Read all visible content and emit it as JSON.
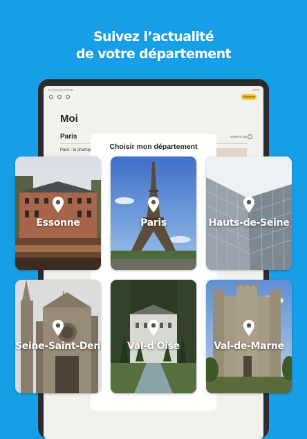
{
  "headline": {
    "line1": "Suivez l’actualité",
    "line2": "de votre département"
  },
  "tablet": {
    "status_left": "09:30 jeudi 18 février",
    "status_right": "100%",
    "subscribe_button": "S'abonner",
    "page_title": "Moi",
    "tab_label": "Paris",
    "see_more": "VOIR PLUS",
    "snippet": "Paris : le champi"
  },
  "modal": {
    "title": "Choisir mon département"
  },
  "departments": [
    {
      "name": "Essonne",
      "icon": "location-pin-icon"
    },
    {
      "name": "Paris",
      "icon": "location-pin-icon"
    },
    {
      "name": "Hauts-de-Seine",
      "icon": "location-pin-icon"
    },
    {
      "name": "Seine-Saint-Denis",
      "icon": "location-pin-icon"
    },
    {
      "name": "Val-d'Oise",
      "icon": "location-pin-icon"
    },
    {
      "name": "Val-de-Marne",
      "icon": "location-pin-icon"
    }
  ],
  "colors": {
    "background": "#169fe6",
    "subscribe": "#f7c418"
  }
}
